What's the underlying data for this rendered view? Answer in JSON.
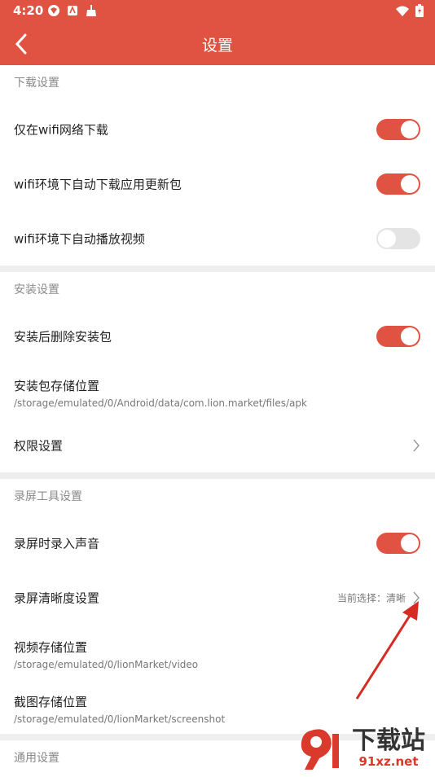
{
  "status_bar": {
    "time": "4:20"
  },
  "app_bar": {
    "title": "设置"
  },
  "sections": {
    "download": {
      "header": "下载设置",
      "wifi_only": "仅在wifi网络下载",
      "auto_update": "wifi环境下自动下载应用更新包",
      "auto_play": "wifi环境下自动播放视频"
    },
    "install": {
      "header": "安装设置",
      "delete_after": "安装后删除安装包",
      "storage_label": "安装包存储位置",
      "storage_path": "/storage/emulated/0/Android/data/com.lion.market/files/apk",
      "permissions": "权限设置"
    },
    "recording": {
      "header": "录屏工具设置",
      "record_sound": "录屏时录入声音",
      "clarity_label": "录屏清晰度设置",
      "clarity_current": "当前选择：清晰",
      "video_label": "视频存储位置",
      "video_path": "/storage/emulated/0/lionMarket/video",
      "screenshot_label": "截图存储位置",
      "screenshot_path": "/storage/emulated/0/lionMarket/screenshot"
    },
    "general": {
      "header": "通用设置"
    }
  },
  "toggles": {
    "wifi_only": true,
    "auto_update": true,
    "auto_play": false,
    "delete_after": true,
    "record_sound": true
  },
  "watermark": {
    "main": "下载站",
    "url": "91xz.net"
  },
  "colors": {
    "accent": "#e05343",
    "toggle_off": "#e4e4e4",
    "annotation_arrow": "#d62b22"
  }
}
